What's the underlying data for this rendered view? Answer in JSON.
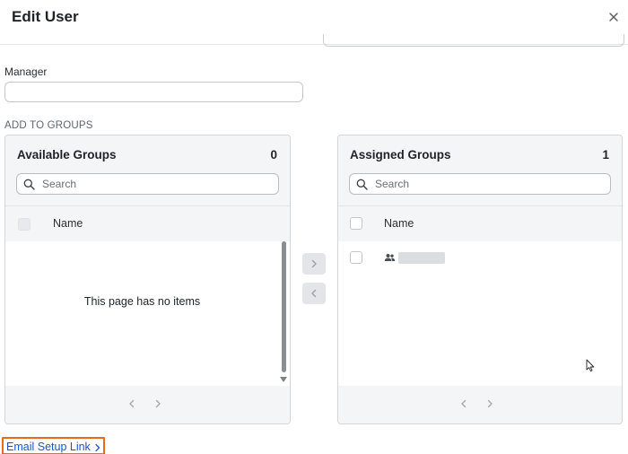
{
  "dialog": {
    "title": "Edit User"
  },
  "manager": {
    "label": "Manager",
    "value": "",
    "placeholder": ""
  },
  "section": {
    "label": "ADD TO GROUPS"
  },
  "available_groups": {
    "title": "Available Groups",
    "count": "0",
    "search_placeholder": "Search",
    "column_name": "Name",
    "empty_message": "This page has no items"
  },
  "assigned_groups": {
    "title": "Assigned Groups",
    "count": "1",
    "search_placeholder": "Search",
    "column_name": "Name",
    "rows": [
      {
        "icon": "group-icon",
        "name_redacted": true
      }
    ]
  },
  "footer": {
    "email_setup_link": "Email Setup Link"
  },
  "colors": {
    "link": "#1a56c4",
    "focus_outline": "#e56b1f",
    "panel_bg": "#f4f5f6"
  }
}
